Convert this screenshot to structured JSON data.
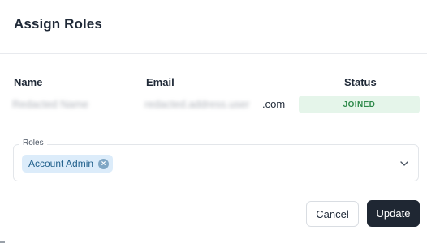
{
  "dialog": {
    "title": "Assign Roles"
  },
  "table": {
    "headers": {
      "name": "Name",
      "email": "Email",
      "status": "Status"
    },
    "row": {
      "name": "Redacted Name",
      "email_hidden": "redacted.address.user",
      "email_suffix": ".com",
      "status": "JOINED"
    }
  },
  "roles": {
    "label": "Roles",
    "selected": [
      "Account Admin"
    ]
  },
  "actions": {
    "cancel_label": "Cancel",
    "update_label": "Update"
  },
  "colors": {
    "status_bg": "#e5f5ea",
    "status_text": "#2f8a4b",
    "chip_bg": "#dcecfa",
    "chip_text": "#1f5f8b",
    "primary": "#1f2733"
  },
  "icons": {
    "chip_remove": "close-circle-icon",
    "dropdown": "chevron-down-icon"
  }
}
